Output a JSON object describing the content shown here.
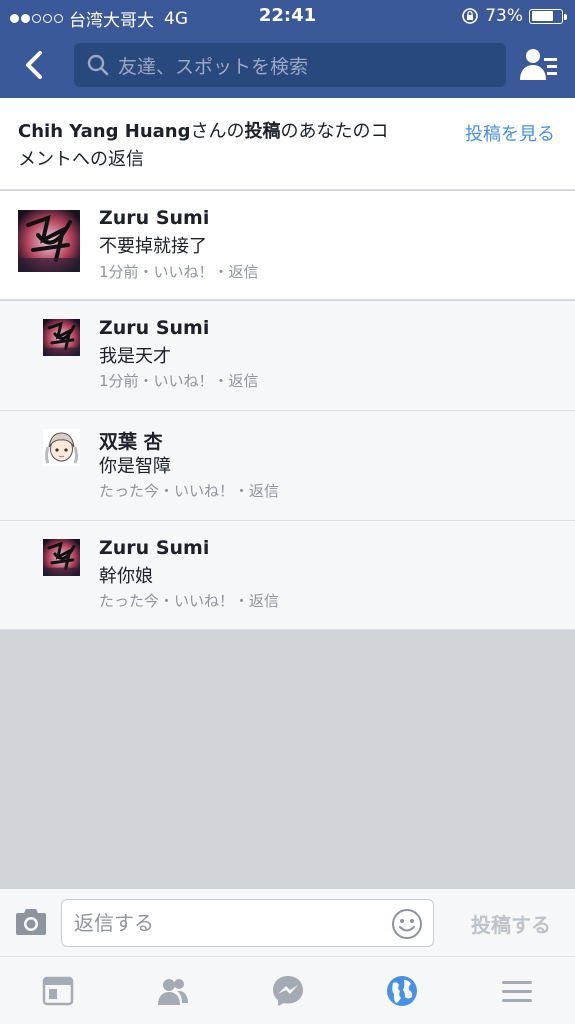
{
  "status_bar": {
    "carrier": "台湾大哥大",
    "network": "4G",
    "time": "22:41",
    "battery": "73%",
    "battery_level": 0.73,
    "signal_bars": 5,
    "signal_filled": 2
  },
  "nav": {
    "search_placeholder": "友達、スポットを検索"
  },
  "header": {
    "author": "Chih Yang Huang",
    "t1": "さんの",
    "post_word": "投稿",
    "t2": "のあなたのコ",
    "line2": "メントへの返信",
    "view_post": "投稿を見る"
  },
  "comments": [
    {
      "name": "Zuru Sumi",
      "text": "不要掉就接了",
      "meta": "1分前・いいね！・返信"
    },
    {
      "name": "Zuru Sumi",
      "text": "我是天才",
      "meta": "1分前・いいね！・返信"
    },
    {
      "name": "双葉 杏",
      "text": "你是智障",
      "meta": "たった今・いいね！・返信"
    },
    {
      "name": "Zuru Sumi",
      "text": "幹你娘",
      "meta": "たった今・いいね！・返信"
    }
  ],
  "composer": {
    "placeholder": "返信する",
    "post_label": "投稿する"
  },
  "colors": {
    "brand": "#3b5998",
    "link": "#4a90e2",
    "active_tab": "#4a90e2"
  },
  "tabs": [
    "news-feed-icon",
    "friends-icon",
    "messenger-icon",
    "notifications-globe-icon",
    "menu-icon"
  ]
}
